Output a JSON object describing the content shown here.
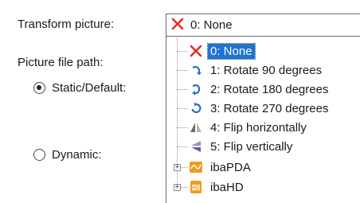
{
  "labels": {
    "transform_picture": "Transform picture:",
    "picture_file_path": "Picture file path:"
  },
  "radios": {
    "static": {
      "label": "Static/Default:",
      "checked": true
    },
    "dynamic": {
      "label": "Dynamic:",
      "checked": false
    }
  },
  "combo": {
    "value": "0: None",
    "icon": "red-x-icon"
  },
  "tree": {
    "items": [
      {
        "label": "0: None",
        "icon": "red-x-icon",
        "selected": true
      },
      {
        "label": "1: Rotate 90 degrees",
        "icon": "rotate-90-icon"
      },
      {
        "label": "2: Rotate 180 degrees",
        "icon": "rotate-180-icon"
      },
      {
        "label": "3: Rotate 270 degrees",
        "icon": "rotate-270-icon"
      },
      {
        "label": "4: Flip horizontally",
        "icon": "flip-horizontal-icon"
      },
      {
        "label": "5: Flip vertically",
        "icon": "flip-vertical-icon"
      }
    ],
    "groups": [
      {
        "label": "ibaPDA",
        "icon": "ibapda-icon",
        "expander": "+"
      },
      {
        "label": "ibaHD",
        "icon": "ibahd-icon",
        "expander": "+"
      }
    ]
  },
  "colors": {
    "selection": "#1f74cf",
    "red_x": "#e0302a",
    "rotate_blue": "#2a6fc9",
    "orange": "#f29b1d"
  }
}
